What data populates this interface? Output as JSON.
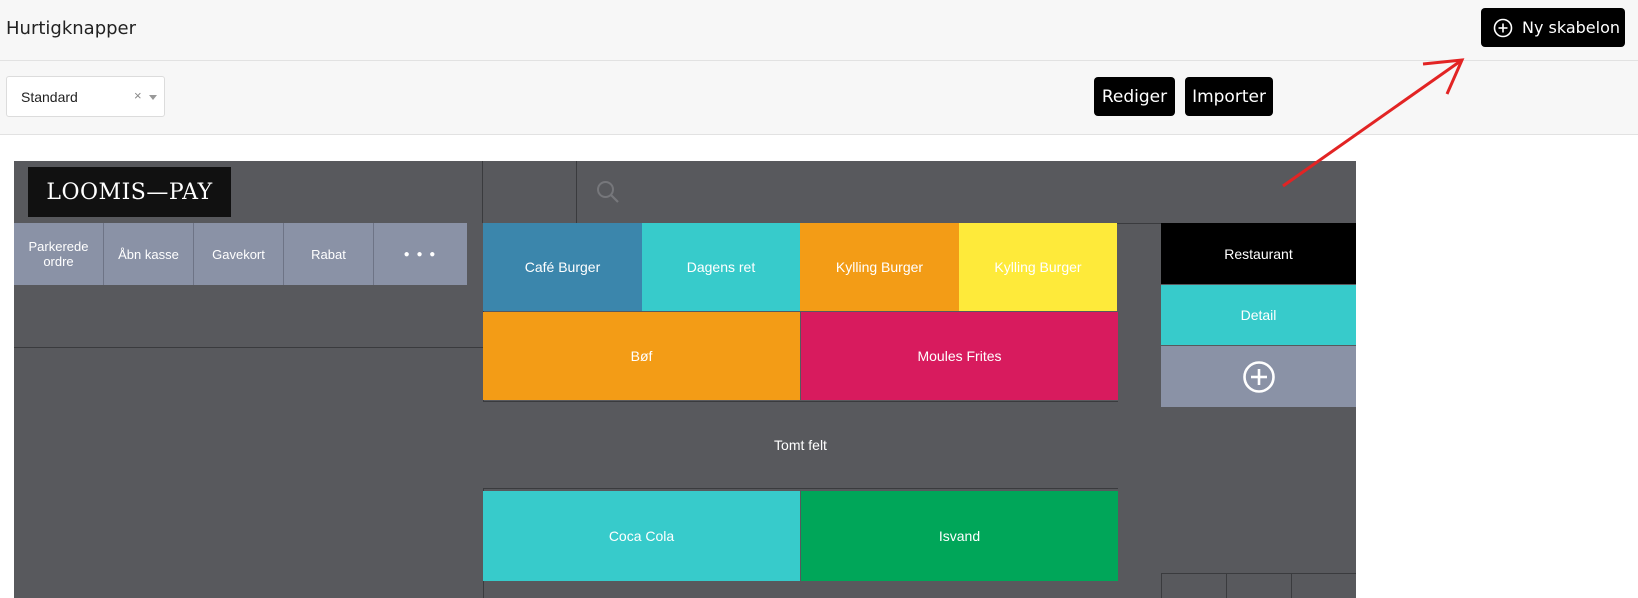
{
  "header": {
    "title": "Hurtigknapper",
    "new_template_label": "Ny skabelon"
  },
  "toolbar": {
    "template_select": {
      "value": "Standard",
      "clear_symbol": "×"
    },
    "edit_label": "Rediger",
    "import_label": "Importer"
  },
  "pos": {
    "logo_text": "LOOMIS—PAY",
    "actions": [
      {
        "label": "Parkerede ordre",
        "name": "action-parked-orders"
      },
      {
        "label": "Åbn kasse",
        "name": "action-open-drawer"
      },
      {
        "label": "Gavekort",
        "name": "action-gift-card"
      },
      {
        "label": "Rabat",
        "name": "action-discount"
      },
      {
        "label": "● ● ●",
        "name": "action-more"
      }
    ],
    "tiles": [
      {
        "label": "Café Burger",
        "color": "#3b86ac"
      },
      {
        "label": "Dagens ret",
        "color": "#37cbcb"
      },
      {
        "label": "Kylling Burger",
        "color": "#f39c16"
      },
      {
        "label": "Kylling Burger",
        "color": "#feea3a"
      },
      {
        "label": "Bøf",
        "color": "#f39c16"
      },
      {
        "label": "Moules Frites",
        "color": "#d81b5e"
      },
      {
        "label": "Tomt felt",
        "color": "#58595d"
      },
      {
        "label": "Coca Cola",
        "color": "#37cbcb"
      },
      {
        "label": "Isvand",
        "color": "#00a659"
      }
    ],
    "categories": [
      {
        "label": "Restaurant",
        "color": "#000000"
      },
      {
        "label": "Detail",
        "color": "#37cbcb"
      }
    ],
    "add_category_color": "#8a92a6"
  },
  "icons": {
    "new_template": "plus-circle-icon",
    "search": "search-icon",
    "add_category": "plus-circle-icon"
  }
}
